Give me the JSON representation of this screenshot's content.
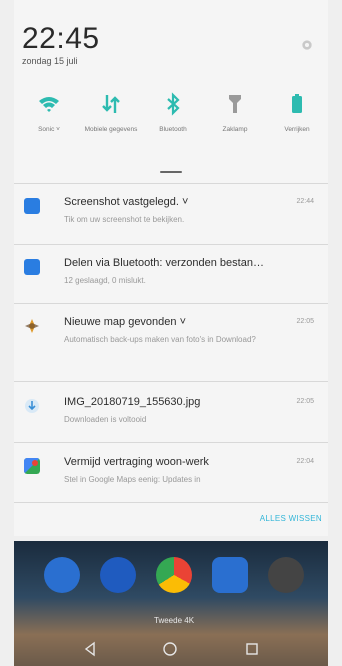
{
  "status": {
    "time": "22:45",
    "date": "zondag 15 juli"
  },
  "quick_settings": [
    {
      "label": "Sonic ˅",
      "icon": "wifi-icon",
      "color": "#2dbbb0"
    },
    {
      "label": "Mobiele gegevens",
      "icon": "mobile-data-icon",
      "color": "#2dbbb0"
    },
    {
      "label": "Bluetooth",
      "icon": "bluetooth-icon",
      "color": "#2dbbb0"
    },
    {
      "label": "Zaklamp",
      "icon": "flashlight-icon",
      "color": "#9a9a9a"
    },
    {
      "label": "Verrijken",
      "icon": "battery-saver-icon",
      "color": "#2dbbb0"
    }
  ],
  "notifications": [
    {
      "title": "Screenshot vastgelegd. ˅",
      "subtitle": "Tik om uw screenshot te bekijken.",
      "time": "22:44",
      "icon": "screenshot-app-icon",
      "color": "#2a7de1"
    },
    {
      "title": "Delen via Bluetooth: verzonden bestan…",
      "subtitle": "12 geslaagd, 0 mislukt.",
      "time": "",
      "icon": "bluetooth-share-icon",
      "color": "#2a7de1"
    },
    {
      "title": "Nieuwe map gevonden ˅",
      "subtitle": "Automatisch back-ups maken van foto's in Download?",
      "time": "22:05",
      "icon": "photos-app-icon",
      "color": "#e09a2b"
    },
    {
      "title": "IMG_20180719_155630.jpg",
      "subtitle": "Downloaden is voltooid",
      "time": "22:05",
      "icon": "download-icon",
      "color": "#3a8fd6"
    },
    {
      "title": "Vermijd vertraging woon-werk",
      "subtitle": "Stel in Google Maps eenig: Updates in",
      "time": "22:04",
      "icon": "maps-app-icon",
      "color": "#34a853"
    }
  ],
  "clear_all": "ALLES WISSEN",
  "home": {
    "dock_label": "Tweede 4K"
  },
  "colors": {
    "accent": "#33b6d8",
    "tile_active": "#2dbbb0"
  }
}
